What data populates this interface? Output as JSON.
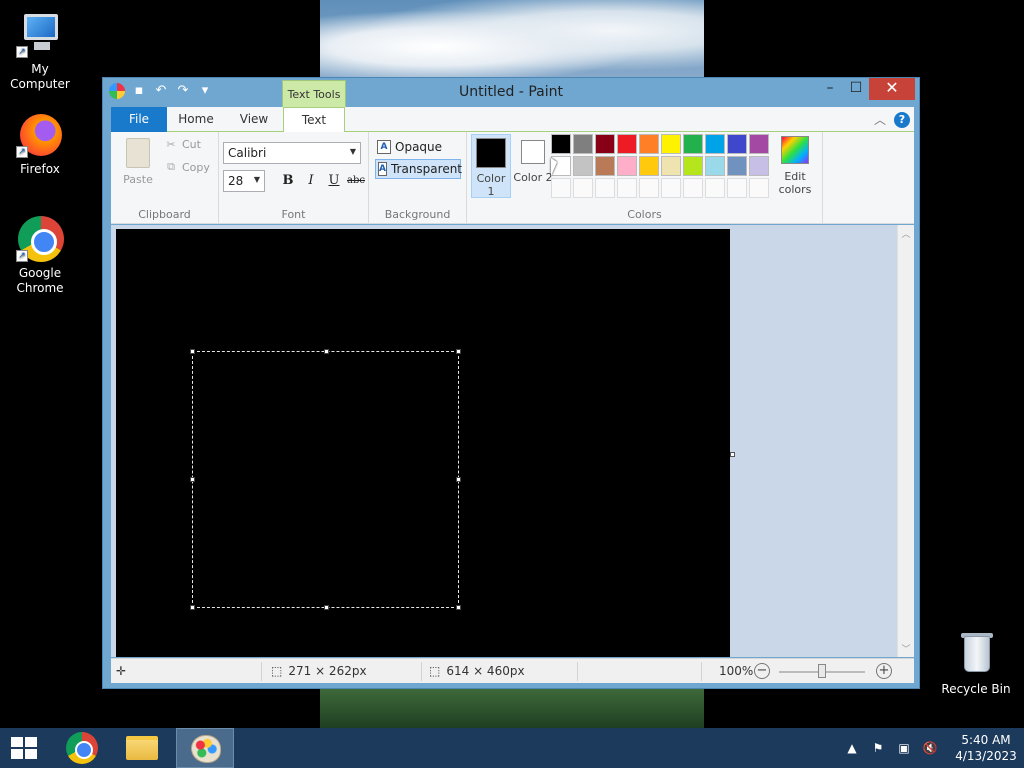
{
  "desktop": {
    "icons": [
      {
        "label": "My Computer",
        "icon": "computer-icon"
      },
      {
        "label": "Firefox",
        "icon": "firefox-icon"
      },
      {
        "label": "Google Chrome",
        "icon": "chrome-icon"
      },
      {
        "label": "Recycle Bin",
        "icon": "recycle-bin-icon"
      }
    ]
  },
  "window": {
    "title": "Untitled - Paint",
    "context_tab": "Text Tools",
    "controls": {
      "minimize": "–",
      "maximize": "☐",
      "close": "✕"
    }
  },
  "tabs": {
    "file": "File",
    "home": "Home",
    "view": "View",
    "text": "Text",
    "active": "Text"
  },
  "ribbon": {
    "clipboard": {
      "label": "Clipboard",
      "paste": "Paste",
      "cut": "Cut",
      "copy": "Copy"
    },
    "font": {
      "label": "Font",
      "family": "Calibri",
      "size": "28",
      "bold": "B",
      "italic": "I",
      "underline": "U",
      "strikethrough": "abc"
    },
    "background": {
      "label": "Background",
      "opaque": "Opaque",
      "transparent": "Transparent",
      "selected": "Transparent"
    },
    "colors": {
      "label": "Colors",
      "color1_label": "Color 1",
      "color2_label": "Color 2",
      "color1": "#000000",
      "color2": "#ffffff",
      "edit": "Edit colors",
      "palette": [
        "#000000",
        "#7f7f7f",
        "#880015",
        "#ed1c24",
        "#ff7f27",
        "#fff200",
        "#22b14c",
        "#00a2e8",
        "#3f48cc",
        "#a349a4",
        "#ffffff",
        "#c3c3c3",
        "#b97a57",
        "#ffaec9",
        "#ffc90e",
        "#efe4b0",
        "#b5e61d",
        "#99d9ea",
        "#7092be",
        "#c8bfe7"
      ],
      "custom_slots": 10
    }
  },
  "status": {
    "selection_size": "271 × 262px",
    "canvas_size": "614 × 460px",
    "zoom": "100%"
  },
  "taskbar": {
    "apps": [
      "start-button",
      "chrome",
      "file-explorer",
      "paint"
    ],
    "active": "paint",
    "time": "5:40 AM",
    "date": "4/13/2023"
  },
  "colors": {
    "accent": "#1979ca",
    "context_tab": "#cde9a8",
    "taskbar": "#1b3a5c",
    "canvas": "#000000"
  }
}
